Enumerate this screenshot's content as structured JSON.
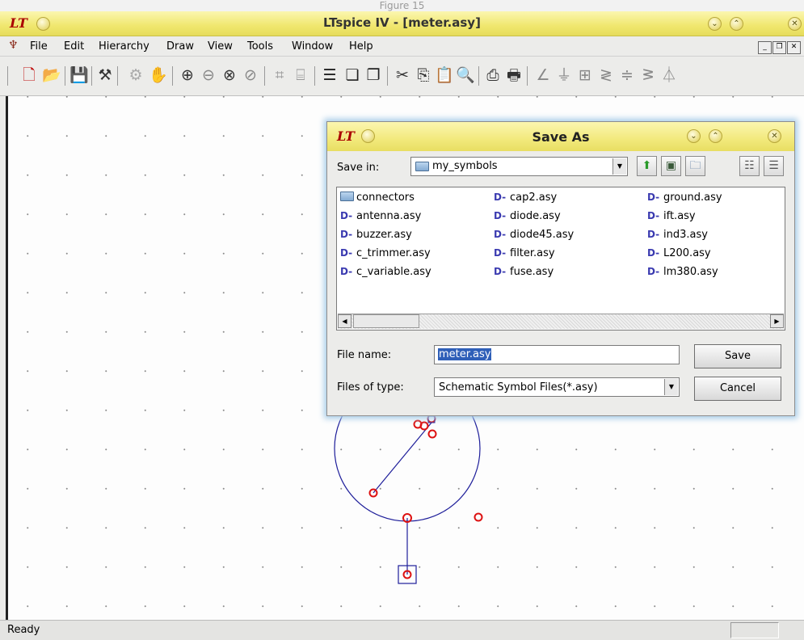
{
  "figure_caption": "Figure 15",
  "window": {
    "app_title": "LTspice IV - [meter.asy]"
  },
  "menubar": {
    "items": [
      {
        "label": "File"
      },
      {
        "label": "Edit"
      },
      {
        "label": "Hierarchy"
      },
      {
        "label": "Draw"
      },
      {
        "label": "View"
      },
      {
        "label": "Tools"
      },
      {
        "label": "Window"
      },
      {
        "label": "Help"
      }
    ],
    "mdi_minimize": "_",
    "mdi_restore": "❐",
    "mdi_close": "✕"
  },
  "toolbar": {
    "icons": [
      "new-schematic-icon",
      "open-icon",
      "save-icon",
      "control-panel-icon",
      "run-icon",
      "halt-icon",
      "zoom-in-icon",
      "zoom-back-icon",
      "zoom-fit-icon",
      "autorange-icon",
      "grid-icon",
      "label-icon",
      "tile-horizontal-icon",
      "cascade-icon",
      "arrange-icon",
      "cut-icon",
      "copy-icon",
      "paste-icon",
      "find-icon",
      "print-setup-icon",
      "print-icon",
      "wire-icon",
      "ground-icon",
      "label-net-icon",
      "resistor-icon",
      "capacitor-icon",
      "inductor-icon",
      "diode-icon"
    ]
  },
  "status": {
    "text": "Ready"
  },
  "dialog": {
    "title": "Save As",
    "save_in_label": "Save in:",
    "save_in_value": "my_symbols",
    "file_name_label": "File name:",
    "file_name_value": "meter.asy",
    "files_of_type_label": "Files of type:",
    "files_of_type_value": "Schematic Symbol Files(*.asy)",
    "save_button": "Save",
    "cancel_button": "Cancel",
    "files": [
      {
        "name": "connectors",
        "kind": "folder"
      },
      {
        "name": "antenna.asy",
        "kind": "symbol"
      },
      {
        "name": "buzzer.asy",
        "kind": "symbol"
      },
      {
        "name": "c_trimmer.asy",
        "kind": "symbol"
      },
      {
        "name": "c_variable.asy",
        "kind": "symbol"
      },
      {
        "name": "cap2.asy",
        "kind": "symbol"
      },
      {
        "name": "diode.asy",
        "kind": "symbol"
      },
      {
        "name": "diode45.asy",
        "kind": "symbol"
      },
      {
        "name": "filter.asy",
        "kind": "symbol"
      },
      {
        "name": "fuse.asy",
        "kind": "symbol"
      },
      {
        "name": "ground.asy",
        "kind": "symbol"
      },
      {
        "name": "ift.asy",
        "kind": "symbol"
      },
      {
        "name": "ind3.asy",
        "kind": "symbol"
      },
      {
        "name": "L200.asy",
        "kind": "symbol"
      },
      {
        "name": "lm380.asy",
        "kind": "symbol"
      }
    ]
  },
  "colors": {
    "title_yellow": "#f0e76e",
    "symbol_line": "#1e1e9a",
    "pin_red": "#dd1111",
    "selection_blue": "#2f5fb8",
    "dialog_glow": "#a8cde8"
  }
}
